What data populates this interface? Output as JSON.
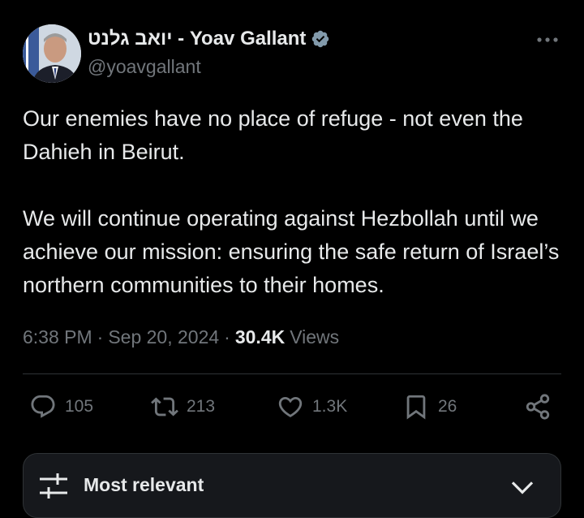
{
  "author": {
    "display_name": "יואב גלנט - Yoav Gallant",
    "handle": "@yoavgallant",
    "verified": true,
    "avatar_icon": "profile-photo"
  },
  "tweet": {
    "paragraphs": [
      "Our enemies have no place of refuge - not even the Dahieh in Beirut.",
      "We will continue operating against Hezbollah until we achieve our mission: ensuring the safe return of Israel’s northern communities to their homes."
    ],
    "time": "6:38 PM",
    "date": "Sep 20, 2024",
    "views_count": "30.4K",
    "views_label": "Views"
  },
  "actions": {
    "replies": "105",
    "reposts": "213",
    "likes": "1.3K",
    "bookmarks": "26"
  },
  "sort": {
    "label": "Most relevant"
  },
  "colors": {
    "background": "#000000",
    "text": "#e7e9ea",
    "secondary": "#71767b",
    "verified": "#829aab",
    "divider": "#2f3336"
  }
}
